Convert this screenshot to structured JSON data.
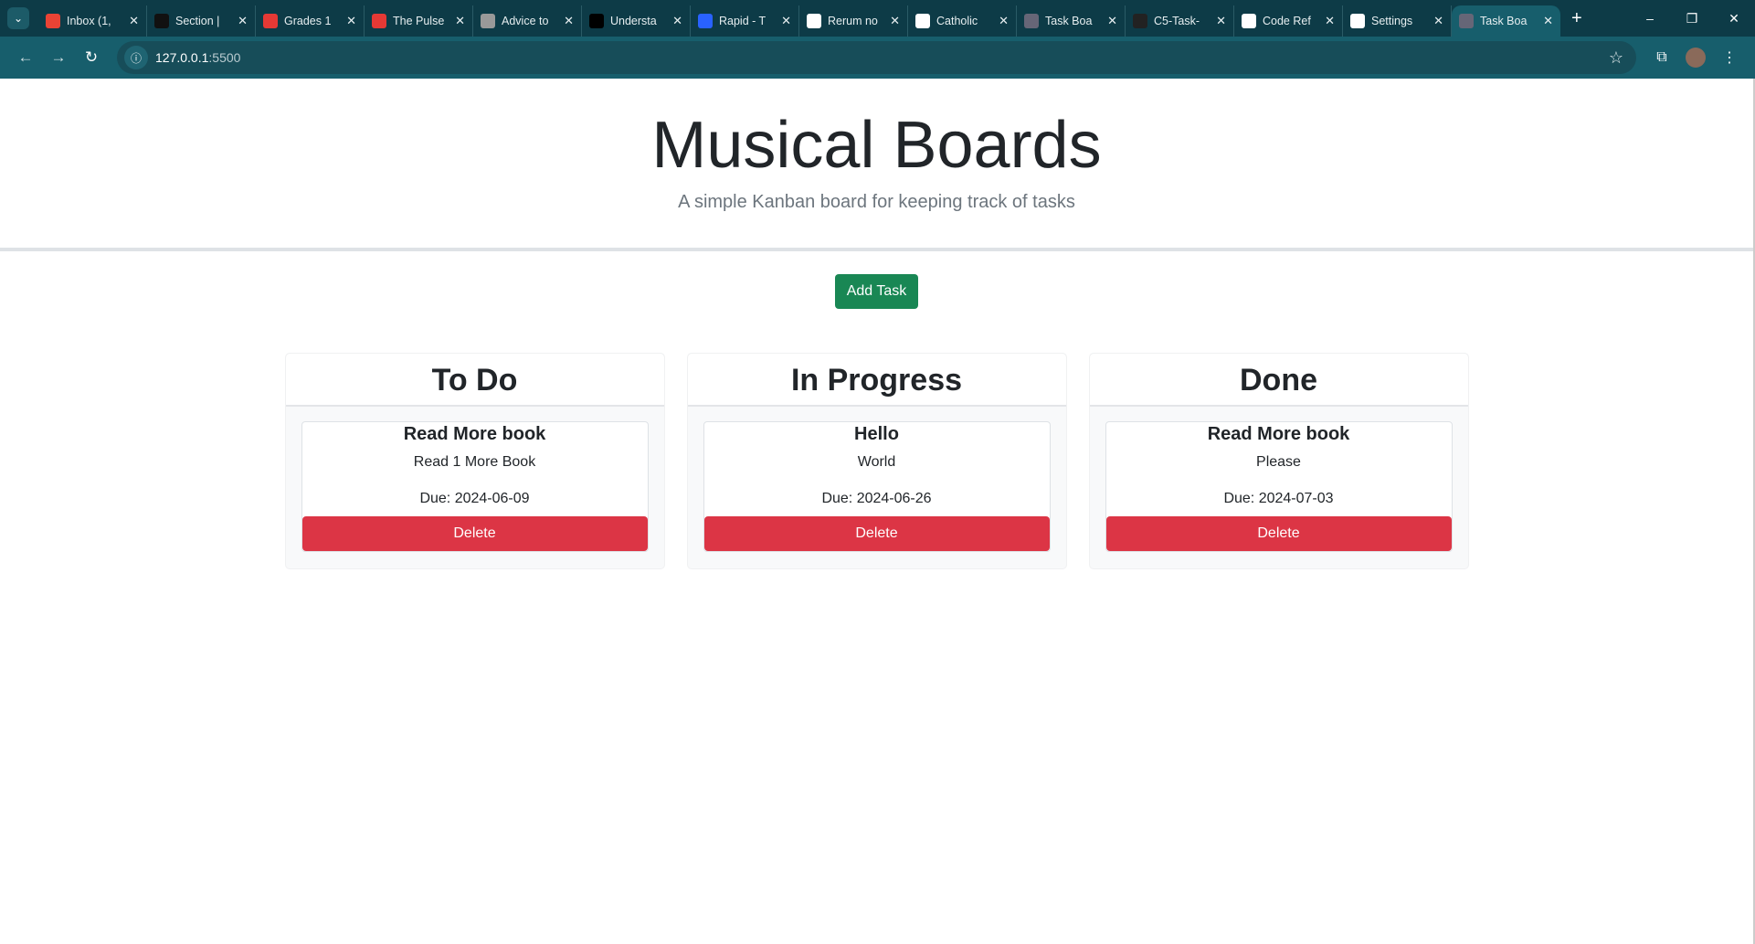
{
  "browser": {
    "tabs": [
      {
        "title": "Inbox (1,",
        "icon": "gmail-icon",
        "color": "#ea4335"
      },
      {
        "title": "Section |",
        "icon": "section-icon",
        "color": "#111"
      },
      {
        "title": "Grades 1",
        "icon": "grades-icon",
        "color": "#e53935"
      },
      {
        "title": "The Pulse",
        "icon": "bar-chart-icon",
        "color": "#e53935"
      },
      {
        "title": "Advice to",
        "icon": "portrait-icon",
        "color": "#999"
      },
      {
        "title": "Understa",
        "icon": "dev-icon",
        "color": "#000"
      },
      {
        "title": "Rapid - T",
        "icon": "rapid-icon",
        "color": "#2962ff"
      },
      {
        "title": "Rerum no",
        "icon": "wikipedia-icon",
        "color": "#fff"
      },
      {
        "title": "Catholic",
        "icon": "wikipedia-icon",
        "color": "#fff"
      },
      {
        "title": "Task Boa",
        "icon": "globe-icon",
        "color": "#667"
      },
      {
        "title": "C5-Task-",
        "icon": "github-icon",
        "color": "#222"
      },
      {
        "title": "Code Ref",
        "icon": "openai-icon",
        "color": "#fff"
      },
      {
        "title": "Settings",
        "icon": "gear-icon",
        "color": "#fff"
      },
      {
        "title": "Task Boa",
        "icon": "globe-icon",
        "color": "#667",
        "active": true
      }
    ],
    "url_host": "127.0.0.1",
    "url_port": ":5500"
  },
  "header": {
    "title": "Musical Boards",
    "subtitle": "A simple Kanban board for keeping track of tasks"
  },
  "add_task_label": "Add Task",
  "columns": [
    {
      "title": "To Do",
      "tasks": [
        {
          "title": "Read More book",
          "description": "Read 1 More Book",
          "due": "Due: 2024-06-09",
          "delete_label": "Delete"
        }
      ]
    },
    {
      "title": "In Progress",
      "tasks": [
        {
          "title": "Hello",
          "description": "World",
          "due": "Due: 2024-06-26",
          "delete_label": "Delete"
        }
      ]
    },
    {
      "title": "Done",
      "tasks": [
        {
          "title": "Read More book",
          "description": "Please",
          "due": "Due: 2024-07-03",
          "delete_label": "Delete"
        }
      ]
    }
  ],
  "colors": {
    "add": "#198754",
    "delete": "#dc3545",
    "chrome": "#0d3b47"
  }
}
